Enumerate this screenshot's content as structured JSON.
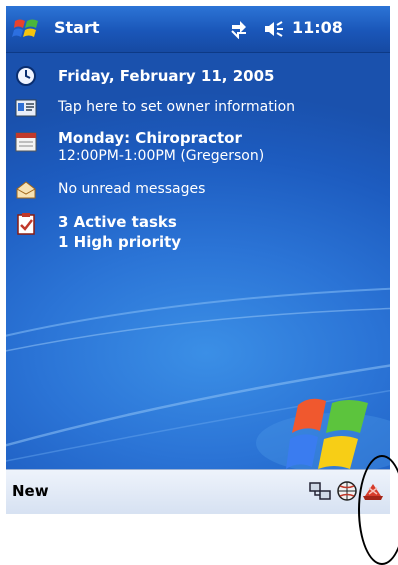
{
  "titlebar": {
    "start_label": "Start",
    "clock": "11:08"
  },
  "today": {
    "date": "Friday, February 11, 2005",
    "owner_prompt": "Tap here to set owner information",
    "appointment_title": "Monday: Chiropractor",
    "appointment_detail": "12:00PM-1:00PM (Gregerson)",
    "messages": "No unread messages",
    "tasks_line1": "3 Active tasks",
    "tasks_line2": "1 High priority"
  },
  "menubar": {
    "new_label": "New"
  },
  "icons": [
    "windows-flag-icon",
    "connectivity-icon",
    "speaker-icon",
    "clock-icon",
    "owner-card-icon",
    "calendar-icon",
    "inbox-envelope-icon",
    "tasks-checklist-icon",
    "windows-logo",
    "sync-icon",
    "globe-icon",
    "notification-icon"
  ],
  "colors": {
    "titlebar": "#1a56b8",
    "today_bg": "#2b74d6",
    "menubar": "#e4ecf8"
  }
}
